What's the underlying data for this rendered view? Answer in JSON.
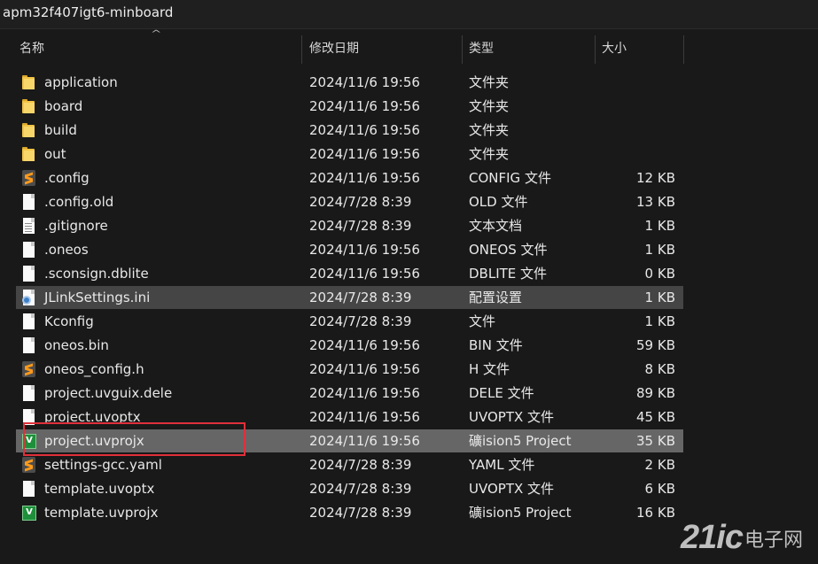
{
  "window": {
    "title": "apm32f407igt6-minboard"
  },
  "columns": {
    "name": "名称",
    "modified": "修改日期",
    "type": "类型",
    "size": "大小"
  },
  "files": [
    {
      "name": "application",
      "modified": "2024/11/6 19:56",
      "type": "文件夹",
      "size": "",
      "icon": "folder-icon"
    },
    {
      "name": "board",
      "modified": "2024/11/6 19:56",
      "type": "文件夹",
      "size": "",
      "icon": "folder-icon"
    },
    {
      "name": "build",
      "modified": "2024/11/6 19:56",
      "type": "文件夹",
      "size": "",
      "icon": "folder-icon"
    },
    {
      "name": "out",
      "modified": "2024/11/6 19:56",
      "type": "文件夹",
      "size": "",
      "icon": "folder-icon"
    },
    {
      "name": ".config",
      "modified": "2024/11/6 19:56",
      "type": "CONFIG 文件",
      "size": "12 KB",
      "icon": "sublime-file-icon"
    },
    {
      "name": ".config.old",
      "modified": "2024/7/28 8:39",
      "type": "OLD 文件",
      "size": "13 KB",
      "icon": "file-icon"
    },
    {
      "name": ".gitignore",
      "modified": "2024/7/28 8:39",
      "type": "文本文档",
      "size": "1 KB",
      "icon": "text-file-icon"
    },
    {
      "name": ".oneos",
      "modified": "2024/11/6 19:56",
      "type": "ONEOS 文件",
      "size": "1 KB",
      "icon": "file-icon"
    },
    {
      "name": ".sconsign.dblite",
      "modified": "2024/11/6 19:56",
      "type": "DBLITE 文件",
      "size": "0 KB",
      "icon": "file-icon"
    },
    {
      "name": "JLinkSettings.ini",
      "modified": "2024/7/28 8:39",
      "type": "配置设置",
      "size": "1 KB",
      "icon": "settings-file-icon",
      "state": "selected"
    },
    {
      "name": "Kconfig",
      "modified": "2024/7/28 8:39",
      "type": "文件",
      "size": "1 KB",
      "icon": "file-icon"
    },
    {
      "name": "oneos.bin",
      "modified": "2024/11/6 19:56",
      "type": "BIN 文件",
      "size": "59 KB",
      "icon": "file-icon"
    },
    {
      "name": "oneos_config.h",
      "modified": "2024/11/6 19:56",
      "type": "H 文件",
      "size": "8 KB",
      "icon": "sublime-file-icon"
    },
    {
      "name": "project.uvguix.dele",
      "modified": "2024/11/6 19:56",
      "type": "DELE 文件",
      "size": "89 KB",
      "icon": "file-icon"
    },
    {
      "name": "project.uvoptx",
      "modified": "2024/11/6 19:56",
      "type": "UVOPTX 文件",
      "size": "45 KB",
      "icon": "file-icon"
    },
    {
      "name": "project.uvprojx",
      "modified": "2024/11/6 19:56",
      "type": "礦ision5 Project",
      "size": "35 KB",
      "icon": "keil-uvision-icon",
      "state": "hover"
    },
    {
      "name": "settings-gcc.yaml",
      "modified": "2024/7/28 8:39",
      "type": "YAML 文件",
      "size": "2 KB",
      "icon": "sublime-file-icon"
    },
    {
      "name": "template.uvoptx",
      "modified": "2024/7/28 8:39",
      "type": "UVOPTX 文件",
      "size": "6 KB",
      "icon": "file-icon"
    },
    {
      "name": "template.uvprojx",
      "modified": "2024/7/28 8:39",
      "type": "礦ision5 Project",
      "size": "16 KB",
      "icon": "keil-uvision-icon"
    }
  ],
  "annotation": {
    "color": "#e0303a",
    "target": "project.uvprojx"
  },
  "watermark": {
    "brand": "21ic",
    "sub": "电子网"
  }
}
